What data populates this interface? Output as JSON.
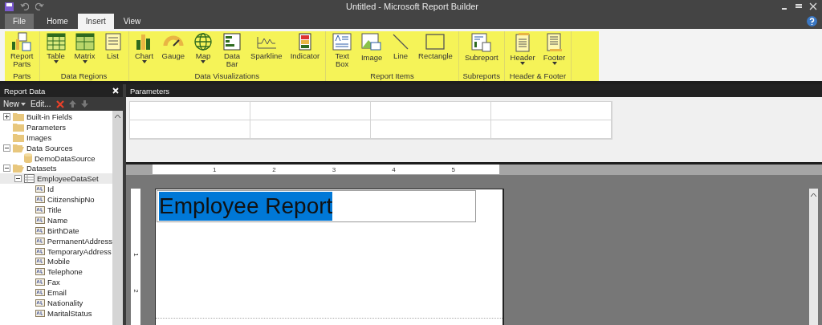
{
  "window": {
    "title": "Untitled - Microsoft Report Builder"
  },
  "tabs": [
    {
      "label": "File",
      "kind": "file",
      "selected": false
    },
    {
      "label": "Home",
      "kind": "tab",
      "selected": false
    },
    {
      "label": "Insert",
      "kind": "tab",
      "selected": true
    },
    {
      "label": "View",
      "kind": "tab",
      "selected": false
    }
  ],
  "ribbon": {
    "groups": [
      {
        "label": "Parts",
        "items": [
          {
            "label": "Report Parts",
            "dropdown": false
          }
        ]
      },
      {
        "label": "Data Regions",
        "items": [
          {
            "label": "Table",
            "dropdown": true
          },
          {
            "label": "Matrix",
            "dropdown": true
          },
          {
            "label": "List",
            "dropdown": false
          }
        ]
      },
      {
        "label": "Data Visualizations",
        "items": [
          {
            "label": "Chart",
            "dropdown": true
          },
          {
            "label": "Gauge",
            "dropdown": false
          },
          {
            "label": "Map",
            "dropdown": true
          },
          {
            "label": "Data Bar",
            "dropdown": false
          },
          {
            "label": "Sparkline",
            "dropdown": false
          },
          {
            "label": "Indicator",
            "dropdown": false
          }
        ]
      },
      {
        "label": "Report Items",
        "items": [
          {
            "label": "Text Box",
            "dropdown": false
          },
          {
            "label": "Image",
            "dropdown": false
          },
          {
            "label": "Line",
            "dropdown": false
          },
          {
            "label": "Rectangle",
            "dropdown": false
          }
        ]
      },
      {
        "label": "Subreports",
        "items": [
          {
            "label": "Subreport",
            "dropdown": false
          }
        ]
      },
      {
        "label": "Header & Footer",
        "items": [
          {
            "label": "Header",
            "dropdown": true
          },
          {
            "label": "Footer",
            "dropdown": true
          }
        ]
      }
    ]
  },
  "report_data": {
    "title": "Report Data",
    "toolbar": {
      "new": "New",
      "edit": "Edit..."
    },
    "tree": [
      {
        "label": "Built-in Fields",
        "kind": "folder",
        "expanded": false,
        "selected": false
      },
      {
        "label": "Parameters",
        "kind": "folder",
        "selected": false
      },
      {
        "label": "Images",
        "kind": "folder",
        "selected": false
      },
      {
        "label": "Data Sources",
        "kind": "folder",
        "expanded": true,
        "selected": false,
        "children": [
          {
            "label": "DemoDataSource",
            "kind": "datasource",
            "selected": false
          }
        ]
      },
      {
        "label": "Datasets",
        "kind": "folder",
        "expanded": true,
        "selected": false,
        "children": [
          {
            "label": "EmployeeDataSet",
            "kind": "dataset",
            "expanded": true,
            "selected": true,
            "children": [
              {
                "label": "Id",
                "kind": "field",
                "selected": false
              },
              {
                "label": "CitizenshipNo",
                "kind": "field",
                "selected": false
              },
              {
                "label": "Title",
                "kind": "field",
                "selected": false
              },
              {
                "label": "Name",
                "kind": "field",
                "selected": false
              },
              {
                "label": "BirthDate",
                "kind": "field",
                "selected": false
              },
              {
                "label": "PermanentAddress",
                "kind": "field",
                "selected": false
              },
              {
                "label": "TemporaryAddress",
                "kind": "field",
                "selected": false
              },
              {
                "label": "Mobile",
                "kind": "field",
                "selected": false
              },
              {
                "label": "Telephone",
                "kind": "field",
                "selected": false
              },
              {
                "label": "Fax",
                "kind": "field",
                "selected": false
              },
              {
                "label": "Email",
                "kind": "field",
                "selected": false
              },
              {
                "label": "Nationality",
                "kind": "field",
                "selected": false
              },
              {
                "label": "MaritalStatus",
                "kind": "field",
                "selected": false
              }
            ]
          }
        ]
      }
    ]
  },
  "parameters": {
    "title": "Parameters"
  },
  "ruler": {
    "horizontal": [
      "1",
      "2",
      "3",
      "4",
      "5"
    ],
    "vertical": [
      "1",
      "2"
    ]
  },
  "report": {
    "textbox": {
      "text": "Employee Report",
      "text_selected": true
    }
  }
}
